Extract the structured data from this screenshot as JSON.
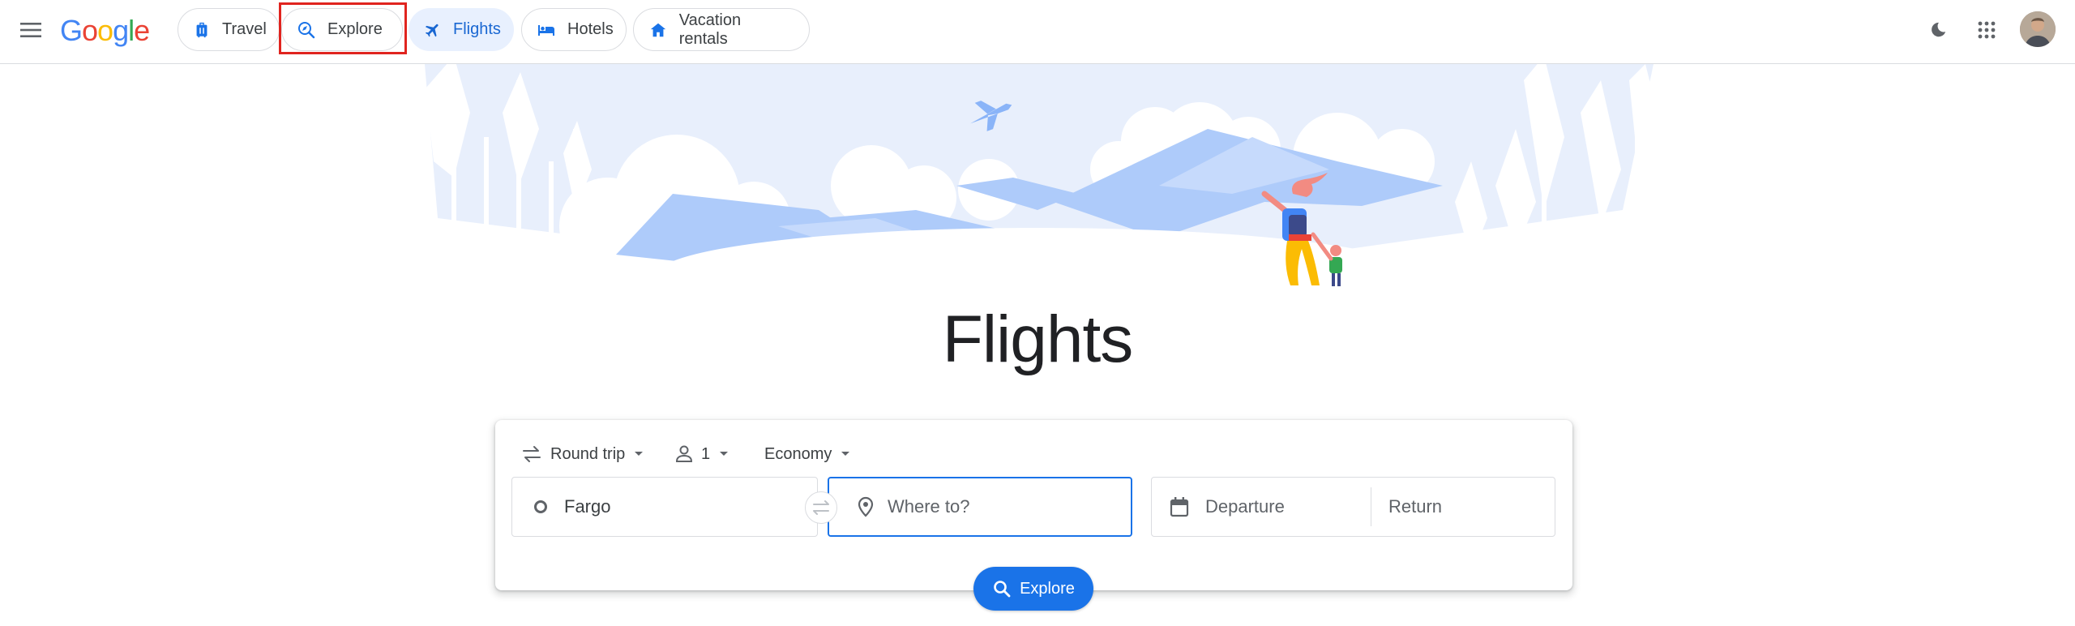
{
  "header": {
    "logo": {
      "letters": [
        "G",
        "o",
        "o",
        "g",
        "l",
        "e"
      ]
    },
    "nav": [
      {
        "label": "Travel",
        "icon": "luggage-icon"
      },
      {
        "label": "Explore",
        "icon": "explore-search-icon"
      },
      {
        "label": "Flights",
        "icon": "airplane-icon",
        "active": true
      },
      {
        "label": "Hotels",
        "icon": "bed-icon"
      },
      {
        "label": "Vacation rentals",
        "icon": "house-icon"
      }
    ],
    "highlighted_item": "Explore",
    "highlight_color": "#e0241f"
  },
  "hero": {
    "title": "Flights"
  },
  "search": {
    "trip_type": "Round trip",
    "passengers": "1",
    "cabin_class": "Economy",
    "from": "Fargo",
    "to_placeholder": "Where to?",
    "departure_placeholder": "Departure",
    "return_placeholder": "Return",
    "explore_label": "Explore"
  },
  "colors": {
    "accent": "#1a73e8",
    "active_chip_bg": "#e8f0fe",
    "hero_sky": "#e8effc"
  }
}
